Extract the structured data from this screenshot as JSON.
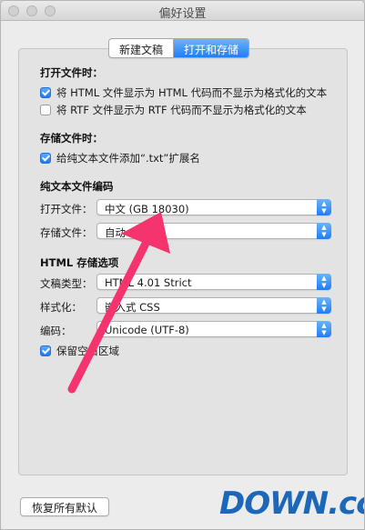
{
  "window": {
    "title": "偏好设置"
  },
  "tabs": [
    {
      "label": "新建文稿",
      "active": false
    },
    {
      "label": "打开和存储",
      "active": true
    }
  ],
  "sections": {
    "open": {
      "title": "打开文件时：",
      "options": [
        {
          "label": "将 HTML 文件显示为 HTML 代码而不显示为格式化的文本",
          "checked": true
        },
        {
          "label": "将 RTF 文件显示为 RTF 代码而不显示为格式化的文本",
          "checked": false
        }
      ]
    },
    "save": {
      "title": "存储文件时：",
      "options": [
        {
          "label": "给纯文本文件添加“.txt”扩展名",
          "checked": true
        }
      ]
    },
    "encoding": {
      "title": "纯文本文件编码",
      "open_label": "打开文件：",
      "open_value": "中文 (GB 18030)",
      "save_label": "存储文件：",
      "save_value": "自动"
    },
    "html": {
      "title": "HTML 存储选项",
      "doctype_label": "文稿类型：",
      "doctype_value": "HTML 4.01 Strict",
      "styling_label": "样式化：",
      "styling_value": "嵌入式 CSS",
      "encoding_label": "编码：",
      "encoding_value": "Unicode (UTF-8)",
      "preserve_label": "保留空白区域",
      "preserve_checked": true
    }
  },
  "footer": {
    "restore_label": "恢复所有默认"
  },
  "watermark": {
    "text": "DOWN.cc"
  },
  "colors": {
    "accent": "#1e7ef6",
    "annotation_arrow": "#f5346e"
  }
}
